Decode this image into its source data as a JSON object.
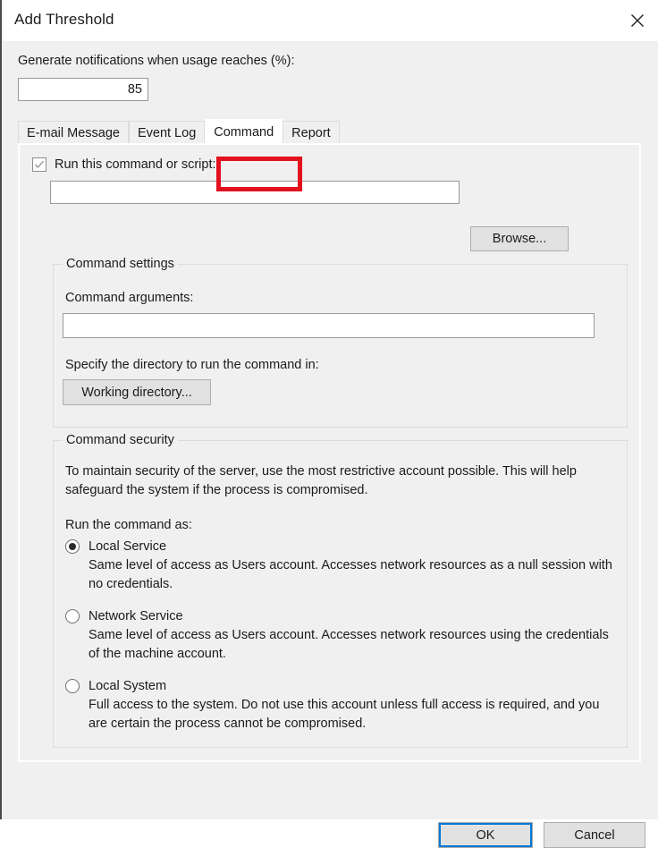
{
  "window": {
    "title": "Add Threshold",
    "close_icon": "close-icon"
  },
  "threshold": {
    "label": "Generate notifications when usage reaches (%):",
    "value": "85",
    "placeholder": ""
  },
  "tabs": [
    {
      "label": "E-mail Message",
      "selected": false
    },
    {
      "label": "Event Log",
      "selected": false
    },
    {
      "label": "Command",
      "selected": true
    },
    {
      "label": "Report",
      "selected": false
    }
  ],
  "annotation": {
    "target": "Command",
    "color": "#e3111e"
  },
  "command_tab": {
    "run_command_checkbox": {
      "label": "Run this command or script:",
      "checked": true,
      "check_icon": "checkmark-icon"
    },
    "command_input": {
      "value": "",
      "placeholder": ""
    },
    "browse_button": "Browse...",
    "settings_group": {
      "legend": "Command settings",
      "arguments_label": "Command arguments:",
      "arguments_input": {
        "value": "",
        "placeholder": ""
      },
      "directory_label": "Specify the directory to run the command in:",
      "working_directory_button": "Working directory..."
    },
    "security_group": {
      "legend": "Command security",
      "description": "To maintain security of the server, use the most restrictive account possible. This will help safeguard the system if the process is compromised.",
      "run_as_label": "Run the command as:",
      "options": [
        {
          "label": "Local Service",
          "selected": true,
          "description": "Same level of access as Users account. Accesses network resources as a null session with no credentials."
        },
        {
          "label": "Network Service",
          "selected": false,
          "description": "Same level of access as Users account. Accesses network resources using the credentials of the machine account."
        },
        {
          "label": "Local System",
          "selected": false,
          "description": "Full access to the system. Do not use this account unless full access is required, and you are certain the process cannot be compromised."
        }
      ]
    }
  },
  "footer": {
    "ok_label": "OK",
    "cancel_label": "Cancel"
  },
  "colors": {
    "accent": "#0078d7",
    "annotation": "#e3111e",
    "dialog_bg": "#f0f0f0",
    "field_bg": "#ffffff"
  }
}
